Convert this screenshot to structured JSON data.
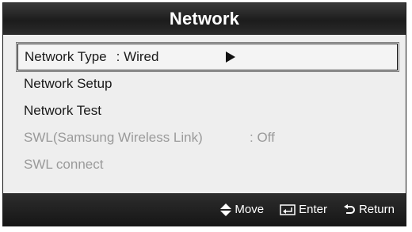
{
  "header": {
    "title": "Network"
  },
  "menu": {
    "items": [
      {
        "label": "Network Type",
        "value": ": Wired"
      },
      {
        "label": "Network Setup"
      },
      {
        "label": "Network Test"
      },
      {
        "label": "SWL(Samsung Wireless Link)",
        "value": ": Off"
      },
      {
        "label": "SWL connect"
      }
    ]
  },
  "footer": {
    "move": "Move",
    "enter": "Enter",
    "return": "Return"
  },
  "icons": {
    "submenu_arrow": "play-arrow-icon",
    "move": "up-down-arrows-icon",
    "enter": "enter-icon",
    "return": "return-arrow-icon"
  },
  "colors": {
    "header_bg": "#1c1c1c",
    "panel_bg": "#eeeeee",
    "disabled_text": "#9a9a9a"
  }
}
